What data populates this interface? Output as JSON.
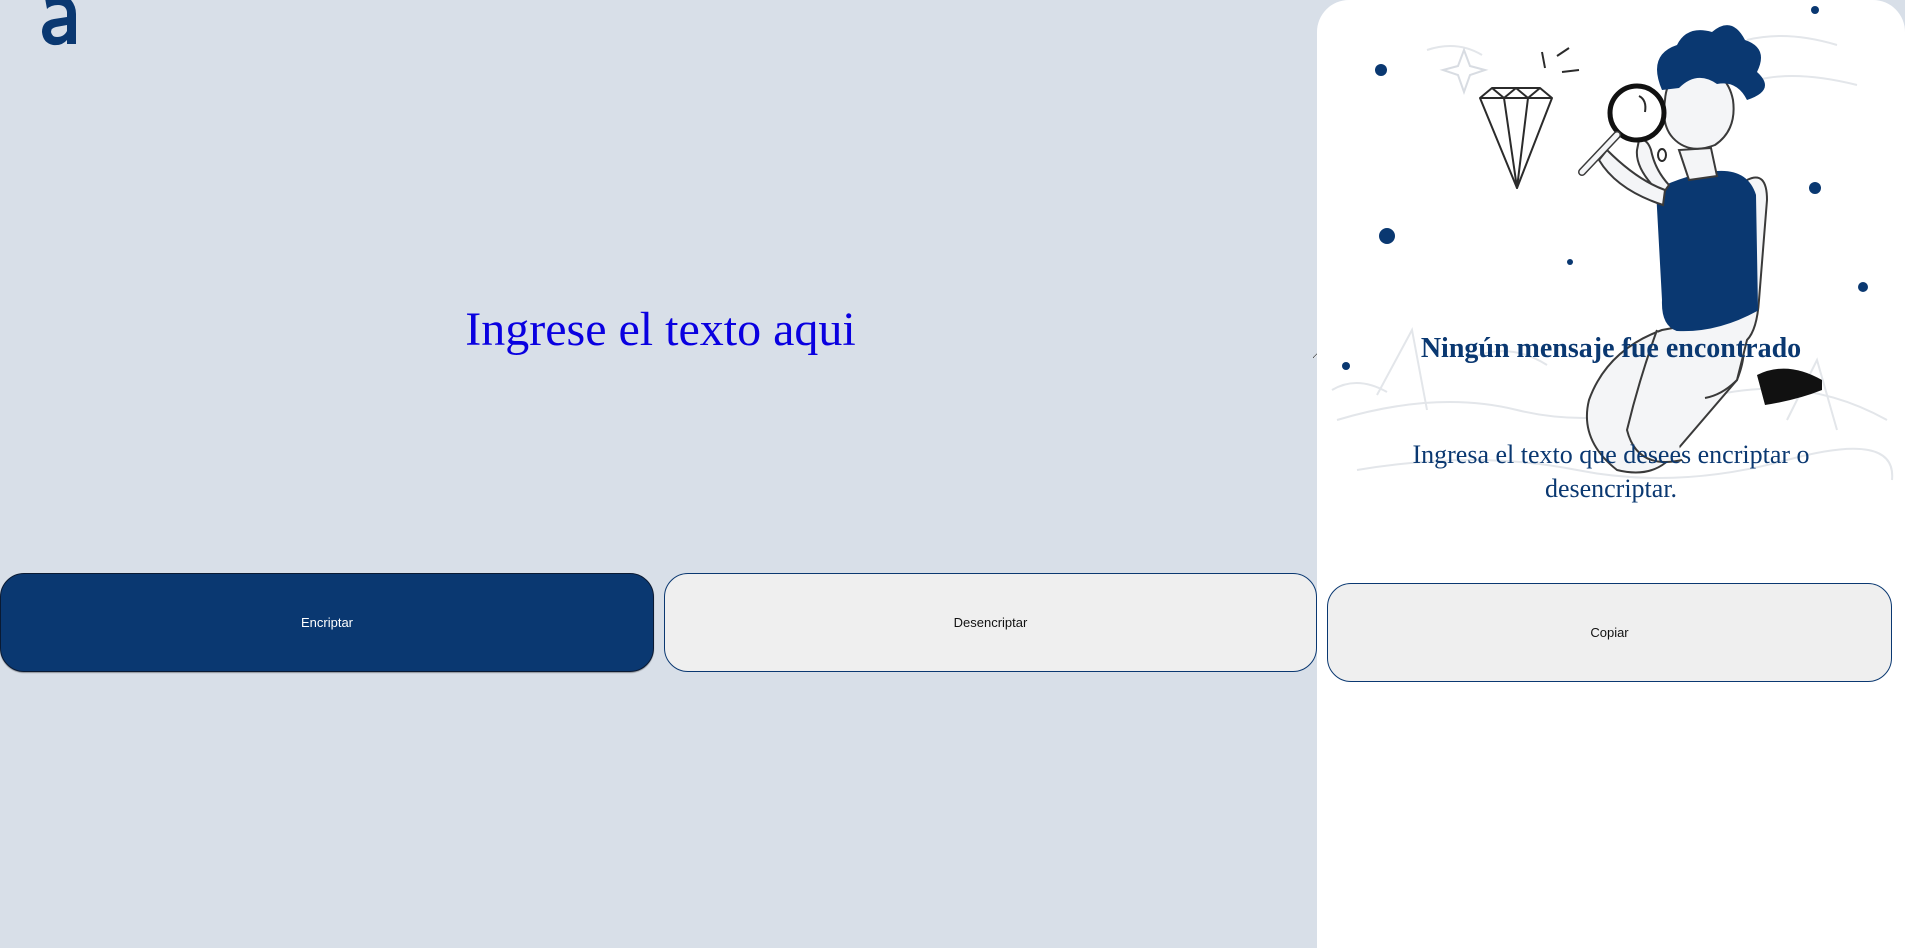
{
  "colors": {
    "page_background": "#D8DFE8",
    "accent_blue": "#0A3871",
    "input_text": "#0A00E0",
    "panel_background": "#FFFFFF",
    "secondary_button": "#EFEFEF"
  },
  "header": {
    "logo_icon": "alura-logo-icon"
  },
  "main": {
    "input_text": "Ingrese el texto aqui",
    "encrypt_label": "Encriptar",
    "decrypt_label": "Desencriptar"
  },
  "panel": {
    "illustration": "person-with-magnifier-and-diamond-illustration",
    "title": "Ningún mensaje fue encontrado",
    "description": "Ingresa el texto que desees encriptar o desencriptar.",
    "copy_label": "Copiar"
  }
}
